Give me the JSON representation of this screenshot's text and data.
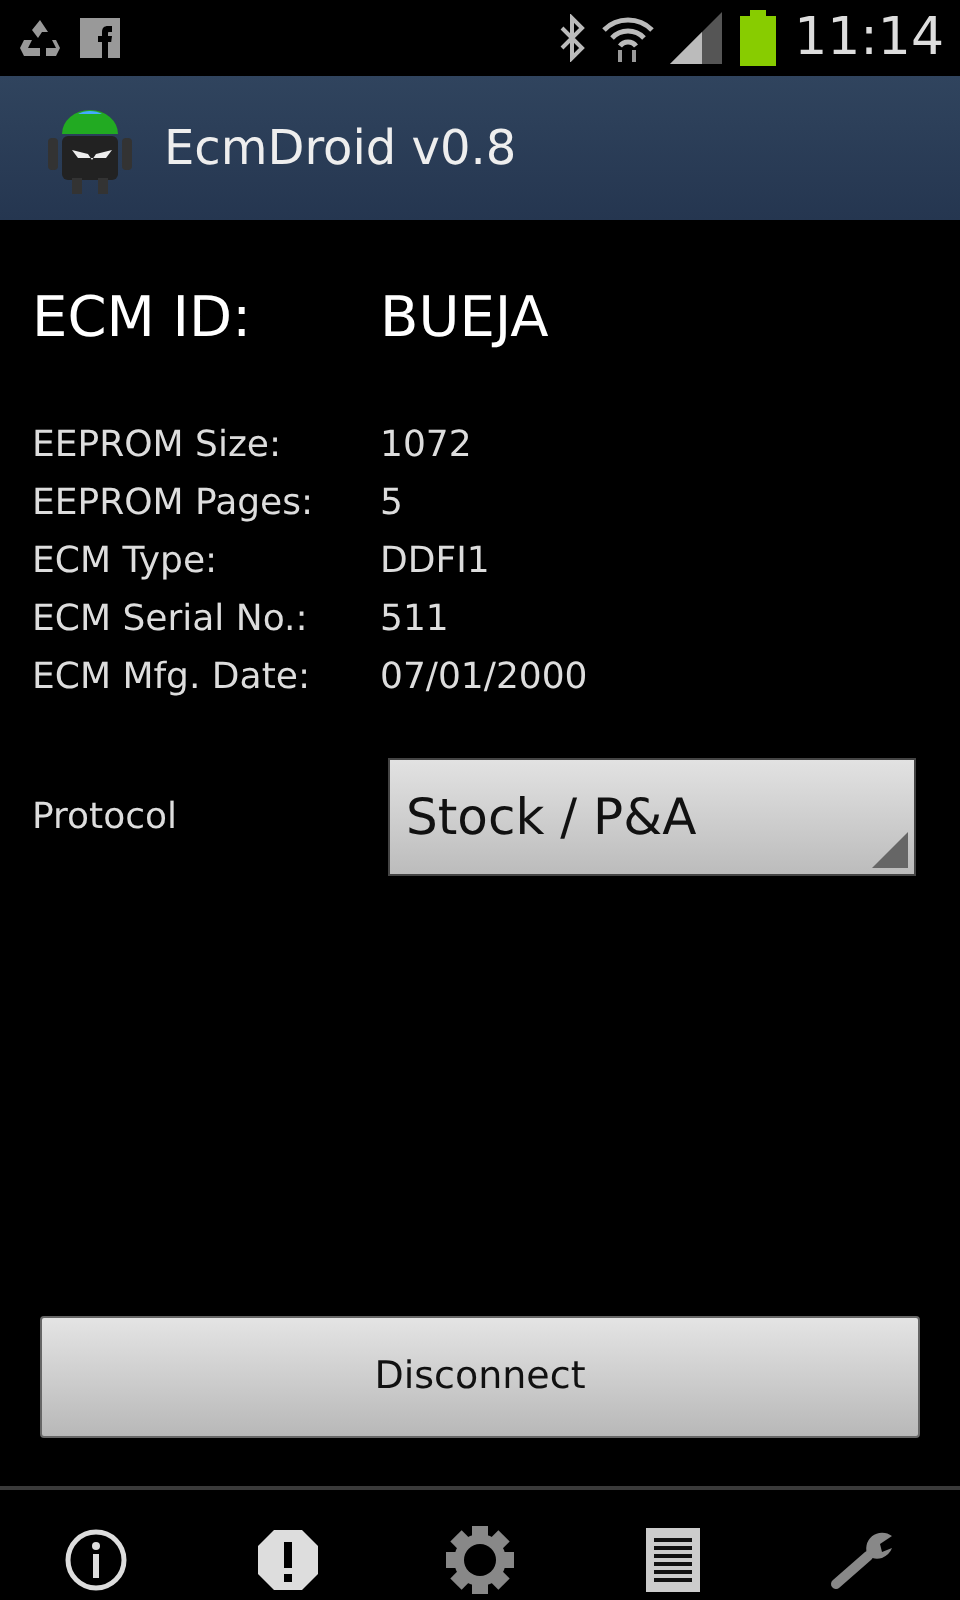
{
  "status_bar": {
    "time": "11:14"
  },
  "app_bar": {
    "title": "EcmDroid v0.8"
  },
  "ecm_id": {
    "label": "ECM ID:",
    "value": "BUEJA"
  },
  "details": [
    {
      "label": "EEPROM Size:",
      "value": "1072"
    },
    {
      "label": "EEPROM Pages:",
      "value": "5"
    },
    {
      "label": "ECM Type:",
      "value": "DDFI1"
    },
    {
      "label": "ECM Serial No.:",
      "value": "511"
    },
    {
      "label": "ECM Mfg. Date:",
      "value": "07/01/2000"
    }
  ],
  "protocol": {
    "label": "Protocol",
    "value": "Stock / P&A"
  },
  "disconnect_button": "Disconnect",
  "bottom_tabs": [
    {
      "kind": "info"
    },
    {
      "kind": "alert"
    },
    {
      "kind": "gear"
    },
    {
      "kind": "list"
    },
    {
      "kind": "wrench"
    }
  ]
}
